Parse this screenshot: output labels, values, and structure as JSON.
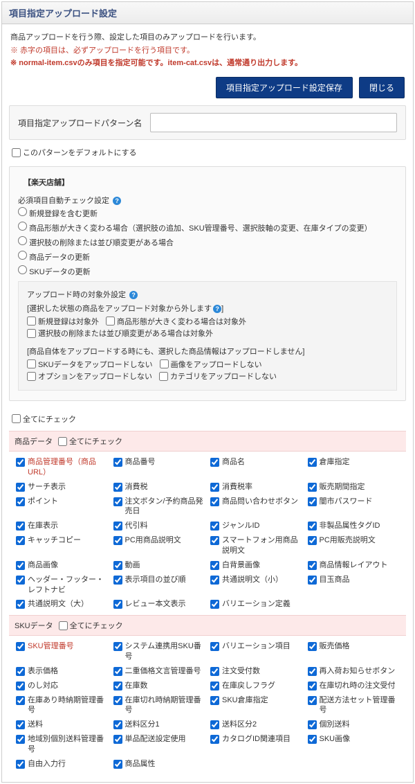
{
  "header": {
    "title": "項目指定アップロード設定"
  },
  "intro": {
    "line1": "商品アップロードを行う際、設定した項目のみアップロードを行います。",
    "line2": "※ 赤字の項目は、必ずアップロードを行う項目です。",
    "line3": "※ normal-item.csvのみ項目を指定可能です。item-cat.csvは、通常通り出力します。"
  },
  "buttons": {
    "save": "項目指定アップロード設定保存",
    "close": "閉じる"
  },
  "pattern": {
    "label": "項目指定アップロードパターン名",
    "value": ""
  },
  "default_check": {
    "label": "このパターンをデフォルトにする"
  },
  "store": {
    "legend": "【楽天店舗】",
    "required_label": "必須項目自動チェック設定",
    "radios": [
      "新規登録を含む更新",
      "商品形態が大きく変わる場合（選択肢の追加、SKU管理番号、選択肢軸の変更、在庫タイプの変更）",
      "選択肢の削除または並び順変更がある場合",
      "商品データの更新",
      "SKUデータの更新"
    ],
    "exclude": {
      "title": "アップロード時の対象外設定",
      "sub1": "[選択した状態の商品をアップロード対象から外します",
      "sub1_end": "]",
      "chk1": [
        "新規登録は対象外",
        "商品形態が大きく変わる場合は対象外",
        "選択肢の削除または並び順変更がある場合は対象外"
      ],
      "sub2": "[商品自体をアップロードする時にも、選択した商品情報はアップロードしません]",
      "chk2": [
        "SKUデータをアップロードしない",
        "画像をアップロードしない",
        "オプションをアップロードしない",
        "カテゴリをアップロードしない"
      ]
    }
  },
  "all_label": "全てにチェック",
  "groups": [
    {
      "title": "商品データ",
      "all": "全てにチェック",
      "items": [
        {
          "l": "商品管理番号（商品URL）",
          "c": true,
          "red": true
        },
        {
          "l": "商品番号",
          "c": true
        },
        {
          "l": "商品名",
          "c": true
        },
        {
          "l": "倉庫指定",
          "c": true
        },
        {
          "l": "サーチ表示",
          "c": true
        },
        {
          "l": "消費税",
          "c": true
        },
        {
          "l": "消費税率",
          "c": true
        },
        {
          "l": "販売期間指定",
          "c": true
        },
        {
          "l": "ポイント",
          "c": true
        },
        {
          "l": "注文ボタン/予約商品発売日",
          "c": true
        },
        {
          "l": "商品問い合わせボタン",
          "c": true
        },
        {
          "l": "闇市パスワード",
          "c": true
        },
        {
          "l": "在庫表示",
          "c": true
        },
        {
          "l": "代引料",
          "c": true
        },
        {
          "l": "ジャンルID",
          "c": true
        },
        {
          "l": "非製品属性タグID",
          "c": true
        },
        {
          "l": "キャッチコピー",
          "c": true
        },
        {
          "l": "PC用商品説明文",
          "c": true
        },
        {
          "l": "スマートフォン用商品説明文",
          "c": true
        },
        {
          "l": "PC用販売説明文",
          "c": true
        },
        {
          "l": "商品画像",
          "c": true
        },
        {
          "l": "動画",
          "c": true
        },
        {
          "l": "白背景画像",
          "c": true
        },
        {
          "l": "商品情報レイアウト",
          "c": true
        },
        {
          "l": "ヘッダー・フッター・レフトナビ",
          "c": true
        },
        {
          "l": "表示項目の並び順",
          "c": true
        },
        {
          "l": "共通説明文（小）",
          "c": true
        },
        {
          "l": "目玉商品",
          "c": true
        },
        {
          "l": "共通説明文（大）",
          "c": true
        },
        {
          "l": "レビュー本文表示",
          "c": true
        },
        {
          "l": "バリエーション定義",
          "c": true
        },
        {
          "l": "",
          "empty": true
        }
      ]
    },
    {
      "title": "SKUデータ",
      "all": "全てにチェック",
      "items": [
        {
          "l": "SKU管理番号",
          "c": true,
          "red": true
        },
        {
          "l": "システム連携用SKU番号",
          "c": true
        },
        {
          "l": "バリエーション項目",
          "c": true
        },
        {
          "l": "販売価格",
          "c": true
        },
        {
          "l": "表示価格",
          "c": true
        },
        {
          "l": "二重価格文言管理番号",
          "c": true
        },
        {
          "l": "注文受付数",
          "c": true
        },
        {
          "l": "再入荷お知らせボタン",
          "c": true
        },
        {
          "l": "のし対応",
          "c": true
        },
        {
          "l": "在庫数",
          "c": true
        },
        {
          "l": "在庫戻しフラグ",
          "c": true
        },
        {
          "l": "在庫切れ時の注文受付",
          "c": true
        },
        {
          "l": "在庫あり時納期管理番号",
          "c": true
        },
        {
          "l": "在庫切れ時納期管理番号",
          "c": true
        },
        {
          "l": "SKU倉庫指定",
          "c": true
        },
        {
          "l": "配送方法セット管理番号",
          "c": true
        },
        {
          "l": "送料",
          "c": true
        },
        {
          "l": "送料区分1",
          "c": true
        },
        {
          "l": "送料区分2",
          "c": true
        },
        {
          "l": "個別送料",
          "c": true
        },
        {
          "l": "地域別個別送料管理番号",
          "c": true
        },
        {
          "l": "単品配送設定使用",
          "c": true
        },
        {
          "l": "カタログID関連項目",
          "c": true
        },
        {
          "l": "SKU画像",
          "c": true
        },
        {
          "l": "自由入力行",
          "c": true
        },
        {
          "l": "商品属性",
          "c": true
        },
        {
          "l": "",
          "empty": true
        },
        {
          "l": "",
          "empty": true
        }
      ]
    }
  ]
}
